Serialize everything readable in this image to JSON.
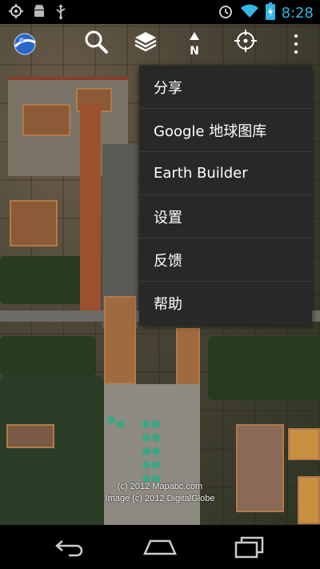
{
  "status_bar": {
    "time": "8:28",
    "left_icons": [
      "gps-icon",
      "android-debug-icon",
      "usb-icon"
    ],
    "right_icons": [
      "alarm-icon",
      "wifi-icon",
      "battery-charging-icon"
    ],
    "time_color": "#33b5e5"
  },
  "toolbar": {
    "icons": [
      "google-earth-logo-icon",
      "search-icon",
      "layers-icon",
      "compass-north-icon",
      "my-location-icon",
      "overflow-menu-icon"
    ],
    "compass_label": "N"
  },
  "menu": {
    "items": [
      {
        "label": "分享"
      },
      {
        "label": "Google 地球图库"
      },
      {
        "label": "Earth Builder"
      },
      {
        "label": "设置"
      },
      {
        "label": "反馈"
      },
      {
        "label": "帮助"
      }
    ]
  },
  "map": {
    "attribution_line1": "(c) 2012 Mapabc.com",
    "attribution_line2": "Image (c) 2012 DigitalGlobe"
  },
  "nav_bar": {
    "icons": [
      "back-icon",
      "home-icon",
      "recent-apps-icon"
    ]
  }
}
